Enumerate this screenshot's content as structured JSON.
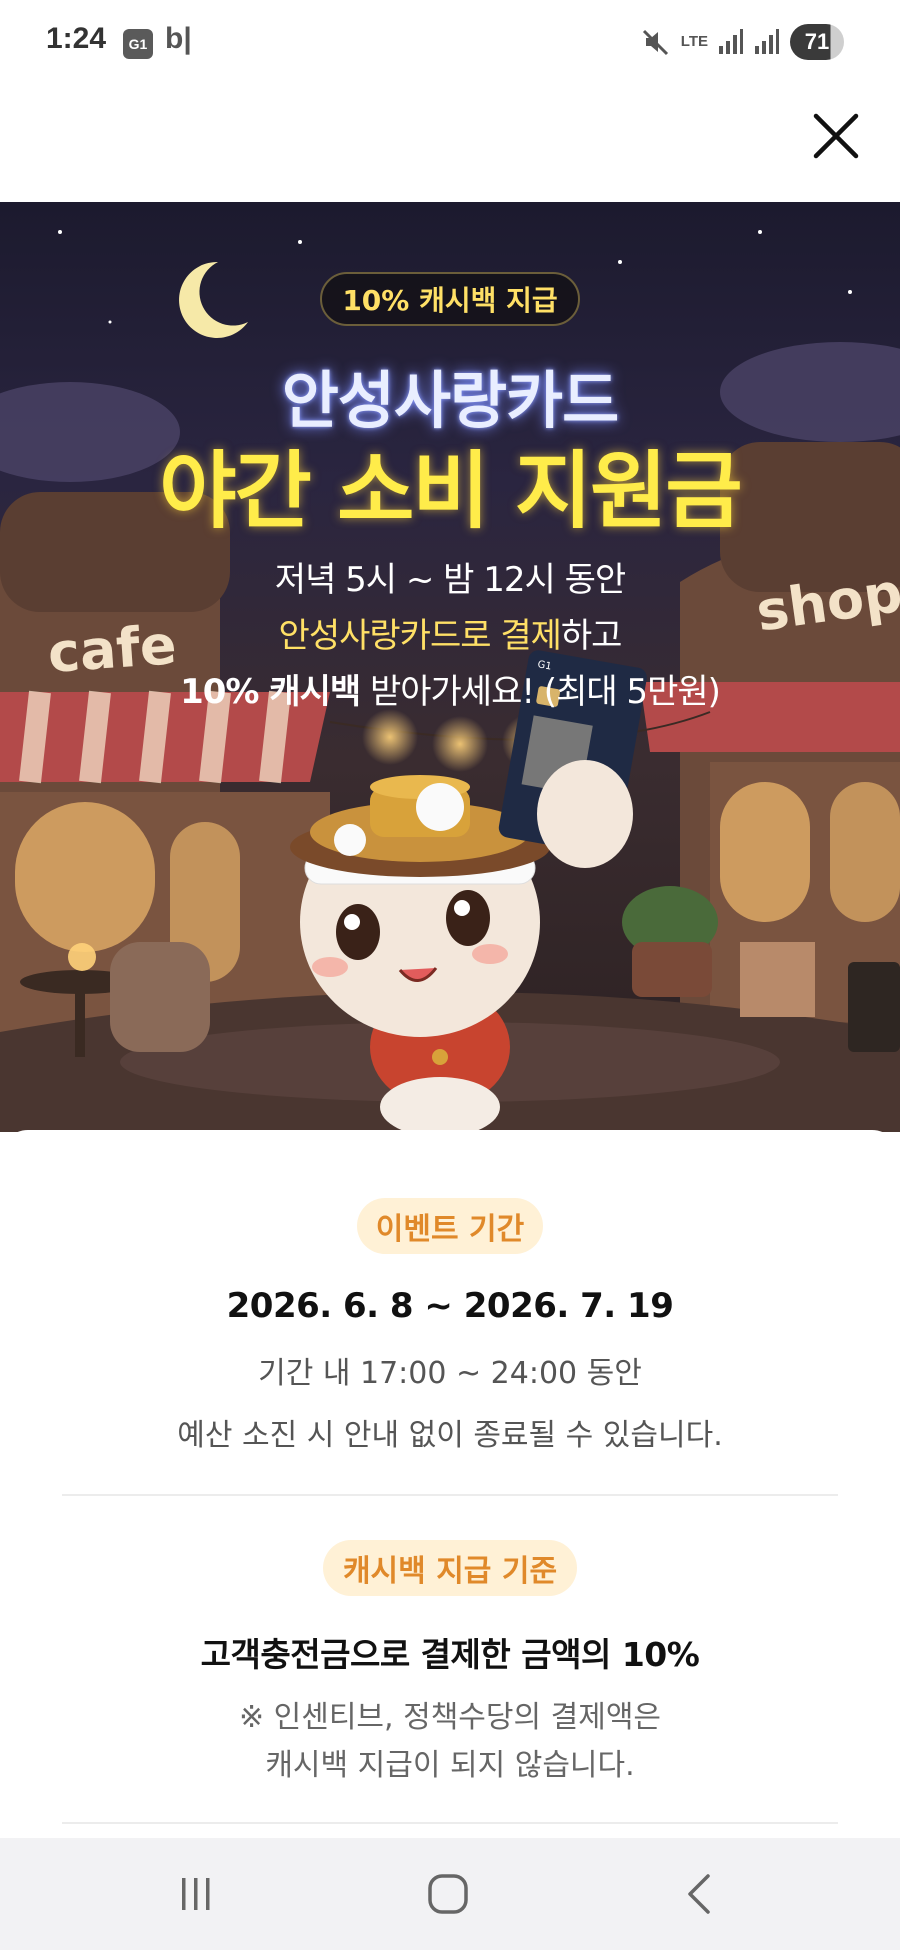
{
  "status_bar": {
    "time": "1:24",
    "app_icon_text": "G1",
    "app_letter": "b|",
    "network": "LTE",
    "battery": "71"
  },
  "banner": {
    "badge": "10% 캐시백 지급",
    "title_line1": "안성사랑카드",
    "title_line2": "야간 소비 지원금",
    "desc_line1": "저녁 5시 ~ 밤 12시 동안",
    "desc_line2_highlight": "안성사랑카드로 결제",
    "desc_line2_rest": "하고",
    "desc_line3_bold": "10% 캐시백",
    "desc_line3_rest": " 받아가세요! (최대 5만원)",
    "sign_cafe": "cafe",
    "sign_shop": "shop"
  },
  "event": {
    "label": "이벤트 기간",
    "date_range": "2026. 6. 8 ~ 2026. 7. 19",
    "time_range": "기간 내 17:00 ~ 24:00 동안",
    "notice": "예산 소진 시 안내 없이 종료될 수 있습니다."
  },
  "criteria": {
    "label": "캐시백 지급 기준",
    "main": "고객충전금으로 결제한 금액의 10%",
    "note_line1": "※ 인센티브, 정책수당의 결제액은",
    "note_line2": "캐시백 지급이 되지 않습니다."
  },
  "colors": {
    "accent_orange": "#e0892a",
    "pill_bg": "#fff1d6",
    "title_yellow": "#ffec4a",
    "banner_bg": "#1c1a2e"
  },
  "icons": {
    "close": "close-icon",
    "recents": "recents-icon",
    "home": "home-icon",
    "back": "back-icon"
  }
}
